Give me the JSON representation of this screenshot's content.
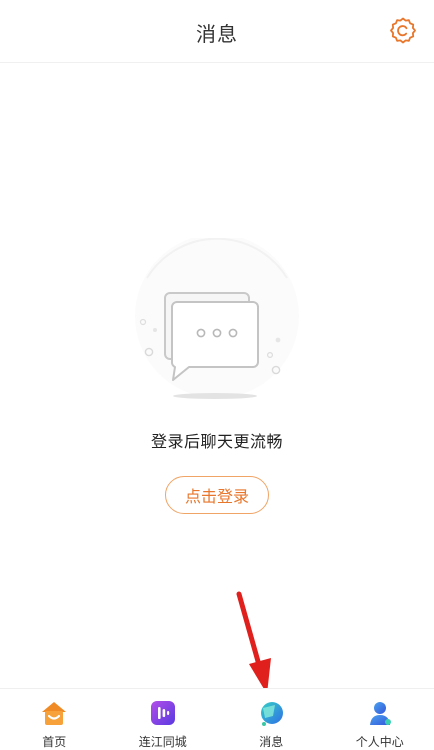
{
  "header": {
    "title": "消息",
    "settings_icon": "gear-icon"
  },
  "empty_state": {
    "illustration_icon": "chat-bubbles-icon",
    "message": "登录后聊天更流畅",
    "login_button_label": "点击登录"
  },
  "tabbar": {
    "tabs": [
      {
        "label": "首页",
        "icon": "home-icon"
      },
      {
        "label": "连江同城",
        "icon": "city-icon"
      },
      {
        "label": "消息",
        "icon": "message-icon",
        "active": true
      },
      {
        "label": "个人中心",
        "icon": "profile-icon"
      }
    ]
  },
  "colors": {
    "accent_orange": "#e8762b",
    "button_border": "#f0a465",
    "annotation_red": "#e0201c",
    "city_purple": "#7b3fe4",
    "message_teal": "#2fc2d6",
    "profile_blue": "#3c7be6"
  }
}
